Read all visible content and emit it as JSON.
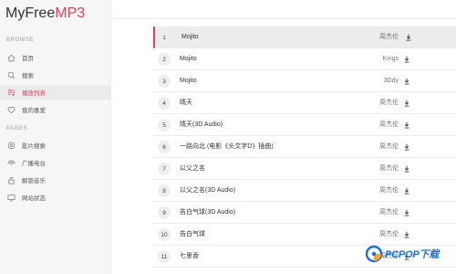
{
  "app": {
    "logo_part1": "MyFree",
    "logo_part2": "MP3"
  },
  "sidebar": {
    "browse_title": "BROWSE",
    "browse_items": [
      {
        "label": "首页",
        "icon": "home-icon"
      },
      {
        "label": "搜索",
        "icon": "search-icon"
      },
      {
        "label": "播放列表",
        "icon": "playlist-icon",
        "active": true
      },
      {
        "label": "我的喜爱",
        "icon": "heart-icon"
      }
    ],
    "pages_title": "PAGES",
    "pages_items": [
      {
        "label": "影片搜索",
        "icon": "film-search-icon"
      },
      {
        "label": "广播电台",
        "icon": "radio-icon"
      },
      {
        "label": "解锁音乐",
        "icon": "unlock-icon"
      },
      {
        "label": "网站状态",
        "icon": "monitor-icon"
      }
    ]
  },
  "tracks": [
    {
      "num": "1",
      "title": "Mojito",
      "artist": "周杰伦",
      "active": true
    },
    {
      "num": "2",
      "title": "Mojito",
      "artist": "Kings"
    },
    {
      "num": "3",
      "title": "Mojito",
      "artist": "3Ddy"
    },
    {
      "num": "4",
      "title": "晴天",
      "artist": "周杰伦"
    },
    {
      "num": "5",
      "title": "晴天(3D Audio)",
      "artist": "周杰伦"
    },
    {
      "num": "6",
      "title": "一路向北 (电影《头文字D》插曲)",
      "artist": "周杰伦"
    },
    {
      "num": "7",
      "title": "以父之名",
      "artist": "周杰伦"
    },
    {
      "num": "8",
      "title": "以父之名(3D Audio)",
      "artist": "周杰伦"
    },
    {
      "num": "9",
      "title": "告白气球(3D Audio)",
      "artist": "周杰伦"
    },
    {
      "num": "10",
      "title": "告白气球",
      "artist": "周杰伦"
    },
    {
      "num": "11",
      "title": "七里香",
      "artist": "周杰伦"
    }
  ],
  "watermark": {
    "text": "PCPOP下载"
  },
  "colors": {
    "accent": "#e0405a",
    "watermark_blue": "#1a6fd8"
  }
}
